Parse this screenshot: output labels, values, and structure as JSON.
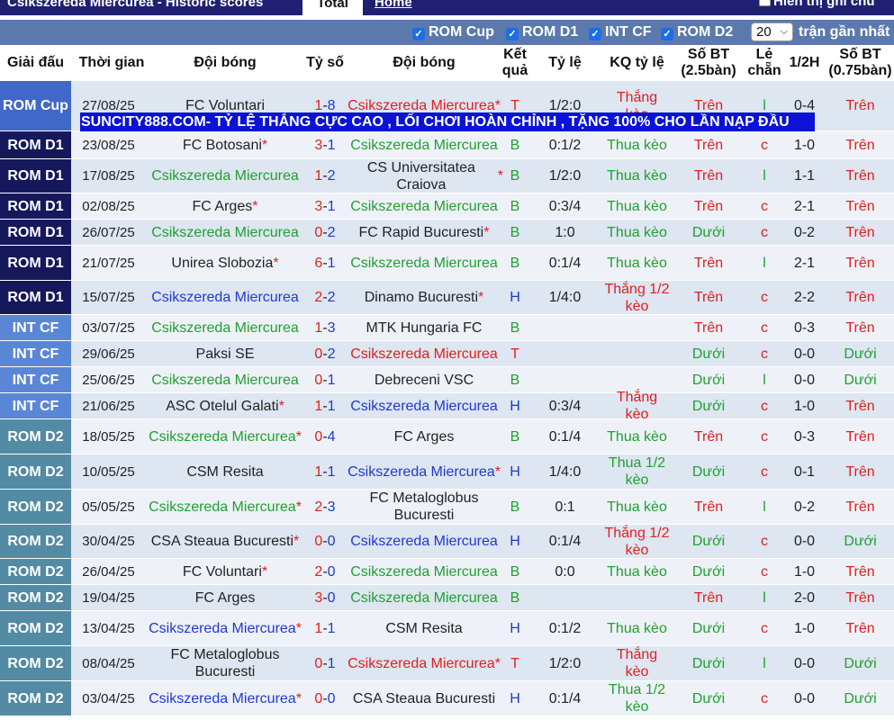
{
  "top": {
    "title": "Csikszereda Miercurea - Historic scores",
    "tab_total": "Total",
    "tab_home": "Home",
    "show_notes": "Hiển thị ghi chú"
  },
  "filters": {
    "items": [
      {
        "label": "ROM Cup",
        "checked": true
      },
      {
        "label": "ROM D1",
        "checked": true
      },
      {
        "label": "INT CF",
        "checked": true
      },
      {
        "label": "ROM D2",
        "checked": true
      }
    ],
    "count_value": "20",
    "count_suffix": "trận gần nhất"
  },
  "columns": {
    "league": "Giải đấu",
    "time": "Thời gian",
    "home": "Đội bóng",
    "score": "Tỷ số",
    "away": "Đội bóng",
    "result": "Kết quả",
    "rate": "Tỷ lệ",
    "kq": "KQ tỷ lệ",
    "sbt": "Số BT (2.5bàn)",
    "le": "Lẻ chẵn",
    "half": "1/2H",
    "sbt2": "Số BT (0.75bàn)"
  },
  "banner": "SUNCITY888.COM- TỶ LỆ THẮNG CỰC CAO , LỐI CHƠI HOÀN CHỈNH , TẶNG 100% CHO LẦN NẠP ĐẦU",
  "colors": {
    "win": "#e02020",
    "draw": "#1f38d6",
    "loss": "#20a030",
    "rom_cup": "#3f68c8",
    "rom_d1": "#16185c",
    "int_cf": "#5a86d6",
    "rom_d2": "#528ba3"
  },
  "rows": [
    {
      "league": "ROM Cup",
      "date": "27/08/25",
      "home": "FC Voluntari",
      "home_star": false,
      "score_h": "1",
      "score_a": "8",
      "away": "Csikszereda Miercurea",
      "away_star": true,
      "result": "T",
      "rate": "1/2:0",
      "kq": "Thắng kèo",
      "sbt": "Trên",
      "le": "l",
      "half": "0-4",
      "sbt2": "Trên"
    },
    {
      "league": "ROM D1",
      "date": "23/08/25",
      "home": "FC Botosani",
      "home_star": true,
      "score_h": "3",
      "score_a": "1",
      "away": "Csikszereda Miercurea",
      "away_star": false,
      "result": "B",
      "rate": "0:1/2",
      "kq": "Thua kèo",
      "sbt": "Trên",
      "le": "c",
      "half": "1-0",
      "sbt2": "Trên"
    },
    {
      "league": "ROM D1",
      "date": "17/08/25",
      "home": "Csikszereda Miercurea",
      "home_star": false,
      "score_h": "1",
      "score_a": "2",
      "away": "CS Universitatea Craiova",
      "away_star": true,
      "result": "B",
      "rate": "1/2:0",
      "kq": "Thua kèo",
      "sbt": "Trên",
      "le": "l",
      "half": "1-1",
      "sbt2": "Trên"
    },
    {
      "league": "ROM D1",
      "date": "02/08/25",
      "home": "FC Arges",
      "home_star": true,
      "score_h": "3",
      "score_a": "1",
      "away": "Csikszereda Miercurea",
      "away_star": false,
      "result": "B",
      "rate": "0:3/4",
      "kq": "Thua kèo",
      "sbt": "Trên",
      "le": "c",
      "half": "2-1",
      "sbt2": "Trên"
    },
    {
      "league": "ROM D1",
      "date": "26/07/25",
      "home": "Csikszereda Miercurea",
      "home_star": false,
      "score_h": "0",
      "score_a": "2",
      "away": "FC Rapid Bucuresti",
      "away_star": true,
      "result": "B",
      "rate": "1:0",
      "kq": "Thua kèo",
      "sbt": "Dưới",
      "le": "c",
      "half": "0-2",
      "sbt2": "Trên"
    },
    {
      "league": "ROM D1",
      "date": "21/07/25",
      "home": "Unirea Slobozia",
      "home_star": true,
      "score_h": "6",
      "score_a": "1",
      "away": "Csikszereda Miercurea",
      "away_star": false,
      "result": "B",
      "rate": "0:1/4",
      "kq": "Thua kèo",
      "sbt": "Trên",
      "le": "l",
      "half": "2-1",
      "sbt2": "Trên"
    },
    {
      "league": "ROM D1",
      "date": "15/07/25",
      "home": "Csikszereda Miercurea",
      "home_star": false,
      "score_h": "2",
      "score_a": "2",
      "away": "Dinamo Bucuresti",
      "away_star": true,
      "result": "H",
      "rate": "1/4:0",
      "kq": "Thắng 1/2 kèo",
      "sbt": "Trên",
      "le": "c",
      "half": "2-2",
      "sbt2": "Trên"
    },
    {
      "league": "INT CF",
      "date": "03/07/25",
      "home": "Csikszereda Miercurea",
      "home_star": false,
      "score_h": "1",
      "score_a": "3",
      "away": "MTK Hungaria FC",
      "away_star": false,
      "result": "B",
      "rate": "",
      "kq": "",
      "sbt": "Trên",
      "le": "c",
      "half": "0-3",
      "sbt2": "Trên"
    },
    {
      "league": "INT CF",
      "date": "29/06/25",
      "home": "Paksi SE",
      "home_star": false,
      "score_h": "0",
      "score_a": "2",
      "away": "Csikszereda Miercurea",
      "away_star": false,
      "result": "T",
      "rate": "",
      "kq": "",
      "sbt": "Dưới",
      "le": "c",
      "half": "0-0",
      "sbt2": "Dưới"
    },
    {
      "league": "INT CF",
      "date": "25/06/25",
      "home": "Csikszereda Miercurea",
      "home_star": false,
      "score_h": "0",
      "score_a": "1",
      "away": "Debreceni VSC",
      "away_star": false,
      "result": "B",
      "rate": "",
      "kq": "",
      "sbt": "Dưới",
      "le": "l",
      "half": "0-0",
      "sbt2": "Dưới"
    },
    {
      "league": "INT CF",
      "date": "21/06/25",
      "home": "ASC Otelul Galati",
      "home_star": true,
      "score_h": "1",
      "score_a": "1",
      "away": "Csikszereda Miercurea",
      "away_star": false,
      "result": "H",
      "rate": "0:3/4",
      "kq": "Thắng kèo",
      "sbt": "Dưới",
      "le": "c",
      "half": "1-0",
      "sbt2": "Trên"
    },
    {
      "league": "ROM D2",
      "date": "18/05/25",
      "home": "Csikszereda Miercurea",
      "home_star": true,
      "score_h": "0",
      "score_a": "4",
      "away": "FC Arges",
      "away_star": false,
      "result": "B",
      "rate": "0:1/4",
      "kq": "Thua kèo",
      "sbt": "Trên",
      "le": "c",
      "half": "0-3",
      "sbt2": "Trên"
    },
    {
      "league": "ROM D2",
      "date": "10/05/25",
      "home": "CSM Resita",
      "home_star": false,
      "score_h": "1",
      "score_a": "1",
      "away": "Csikszereda Miercurea",
      "away_star": true,
      "result": "H",
      "rate": "1/4:0",
      "kq": "Thua 1/2 kèo",
      "sbt": "Dưới",
      "le": "c",
      "half": "0-1",
      "sbt2": "Trên"
    },
    {
      "league": "ROM D2",
      "date": "05/05/25",
      "home": "Csikszereda Miercurea",
      "home_star": true,
      "score_h": "2",
      "score_a": "3",
      "away": "FC Metaloglobus Bucuresti",
      "away_star": false,
      "result": "B",
      "rate": "0:1",
      "kq": "Thua kèo",
      "sbt": "Trên",
      "le": "l",
      "half": "0-2",
      "sbt2": "Trên"
    },
    {
      "league": "ROM D2",
      "date": "30/04/25",
      "home": "CSA Steaua Bucuresti",
      "home_star": true,
      "score_h": "0",
      "score_a": "0",
      "away": "Csikszereda Miercurea",
      "away_star": false,
      "result": "H",
      "rate": "0:1/4",
      "kq": "Thắng 1/2 kèo",
      "sbt": "Dưới",
      "le": "c",
      "half": "0-0",
      "sbt2": "Dưới"
    },
    {
      "league": "ROM D2",
      "date": "26/04/25",
      "home": "FC Voluntari",
      "home_star": true,
      "score_h": "2",
      "score_a": "0",
      "away": "Csikszereda Miercurea",
      "away_star": false,
      "result": "B",
      "rate": "0:0",
      "kq": "Thua kèo",
      "sbt": "Dưới",
      "le": "c",
      "half": "1-0",
      "sbt2": "Trên"
    },
    {
      "league": "ROM D2",
      "date": "19/04/25",
      "home": "FC Arges",
      "home_star": false,
      "score_h": "3",
      "score_a": "0",
      "away": "Csikszereda Miercurea",
      "away_star": false,
      "result": "B",
      "rate": "",
      "kq": "",
      "sbt": "Trên",
      "le": "l",
      "half": "2-0",
      "sbt2": "Trên"
    },
    {
      "league": "ROM D2",
      "date": "13/04/25",
      "home": "Csikszereda Miercurea",
      "home_star": true,
      "score_h": "1",
      "score_a": "1",
      "away": "CSM Resita",
      "away_star": false,
      "result": "H",
      "rate": "0:1/2",
      "kq": "Thua kèo",
      "sbt": "Dưới",
      "le": "c",
      "half": "1-0",
      "sbt2": "Trên"
    },
    {
      "league": "ROM D2",
      "date": "08/04/25",
      "home": "FC Metaloglobus Bucuresti",
      "home_star": false,
      "score_h": "0",
      "score_a": "1",
      "away": "Csikszereda Miercurea",
      "away_star": true,
      "result": "T",
      "rate": "1/2:0",
      "kq": "Thắng kèo",
      "sbt": "Dưới",
      "le": "l",
      "half": "0-0",
      "sbt2": "Dưới"
    },
    {
      "league": "ROM D2",
      "date": "03/04/25",
      "home": "Csikszereda Miercurea",
      "home_star": true,
      "score_h": "0",
      "score_a": "0",
      "away": "CSA Steaua Bucuresti",
      "away_star": false,
      "result": "H",
      "rate": "0:1/4",
      "kq": "Thua 1/2 kèo",
      "sbt": "Dưới",
      "le": "c",
      "half": "0-0",
      "sbt2": "Dưới"
    }
  ]
}
